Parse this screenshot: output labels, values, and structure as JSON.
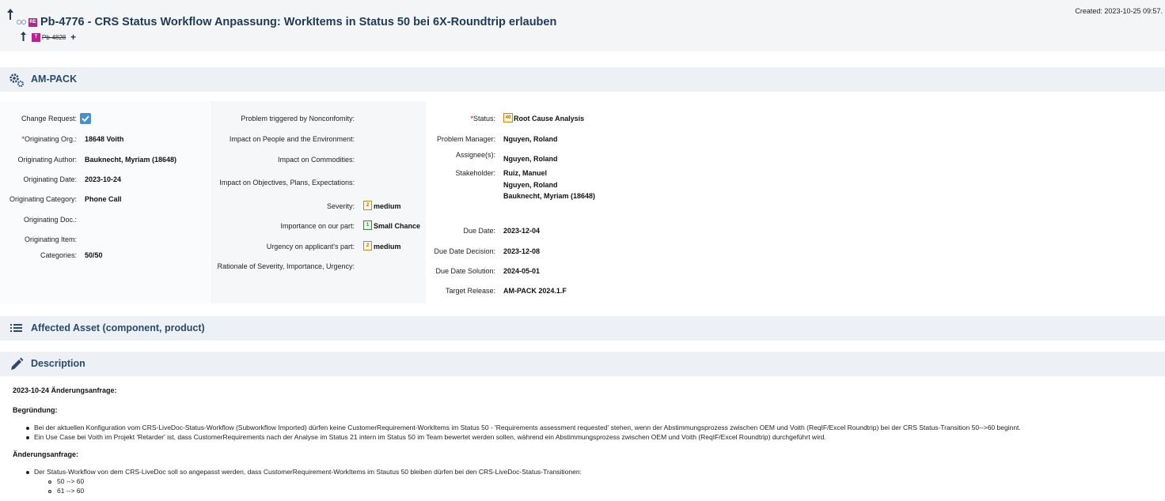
{
  "header": {
    "title": "Pb-4776 - CRS Status Workflow Anpassung: WorkItems in Status 50 bei 6X-Roundtrip erlauben",
    "created": "Created: 2023-10-25 09:57.",
    "req_badge": "RE",
    "task_badge": "T",
    "parent_item": "Pb-4828",
    "add_symbol": "+"
  },
  "sections": {
    "project": "AM-PACK",
    "affected": "Affected Asset (component, product)",
    "description": "Description"
  },
  "col1": {
    "change_request_label": "Change Request:",
    "orig_org_label": "Originating Org.:",
    "orig_org_value": "18648 Voith",
    "orig_author_label": "Originating Author:",
    "orig_author_value": "Bauknecht, Myriam (18648)",
    "orig_date_label": "Originating Date:",
    "orig_date_value": "2023-10-24",
    "orig_cat_label": "Originating Category:",
    "orig_cat_value": "Phone Call",
    "orig_doc_label": "Originating Doc.:",
    "orig_item_label": "Originating Item:",
    "categories_label": "Categories:",
    "categories_value": "50/50"
  },
  "col2": {
    "nonconf_label": "Problem triggered by Nonconfomity:",
    "people_label": "Impact on People and the Environment:",
    "commodities_label": "Impact on Commodities:",
    "objectives_label": "Impact on Objectives, Plans, Expectations:",
    "severity_label": "Severity:",
    "severity_value": "medium",
    "importance_label": "Importance on our part:",
    "importance_value": "Small Chance",
    "urgency_label": "Urgency on applicant's part:",
    "urgency_value": "medium",
    "rationale_label": "Rationale of Severity, Importance, Urgency:"
  },
  "col3": {
    "status_label": "Status:",
    "status_icon_text": "40",
    "status_value": "Root Cause Analysis",
    "pm_label": "Problem Manager:",
    "pm_value": "Nguyen, Roland",
    "assignee_label": "Assignee(s):",
    "assignee_value": "Nguyen, Roland",
    "stakeholder_label": "Stakeholder:",
    "stakeholders": [
      "Ruiz, Manuel",
      "Nguyen, Roland",
      "Bauknecht, Myriam (18648)"
    ],
    "due_label": "Due Date:",
    "due_value": "2023-12-04",
    "due_dec_label": "Due Date Decision:",
    "due_dec_value": "2023-12-08",
    "due_sol_label": "Due Date Solution:",
    "due_sol_value": "2024-05-01",
    "target_label": "Target Release:",
    "target_value": "AM-PACK 2024.1.F"
  },
  "description": {
    "heading": "2023-10-24 Änderungsanfrage:",
    "begruendung": "Begründung:",
    "b1": "Bei der aktuellen Konfiguration vom CRS-LiveDoc-Status-Workflow (Subworkflow Imported) dürfen keine CustomerRequirement-WorkItems im Status 50 - 'Requirements assessment requested' stehen, wenn der Abstimmungsprozess zwischen OEM und Voith (ReqIF/Excel Roundtrip) bei der CRS Status-Transition 50-->60 beginnt.",
    "b2": "Ein Use Case bei Voith im Projekt 'Retarder' ist, dass CustomerRequirements nach der Analyse im Status 21 intern im Status 50 im Team bewertet werden sollen, während ein Abstimmungsprozess zwischen OEM und Voith (ReqIF/Excel Roundtrip) durchgeführt wird.",
    "aenderung": "Änderungsanfrage:",
    "c1": "Der Status-Workflow von dem CRS-LiveDoc soll so angepasst werden, dass CustomerRequirement-WorkItems im Stautus 50 bleiben dürfen bei den CRS-LiveDoc-Status-Transitionen:",
    "s1": "50 --> 60",
    "s2": "61 --> 60"
  },
  "colors": {
    "accent": "#1f3a55",
    "section_bg": "#edf0f4",
    "required": "#cc0000",
    "checkbox": "#4a90c8",
    "badge": "#b0278e"
  }
}
